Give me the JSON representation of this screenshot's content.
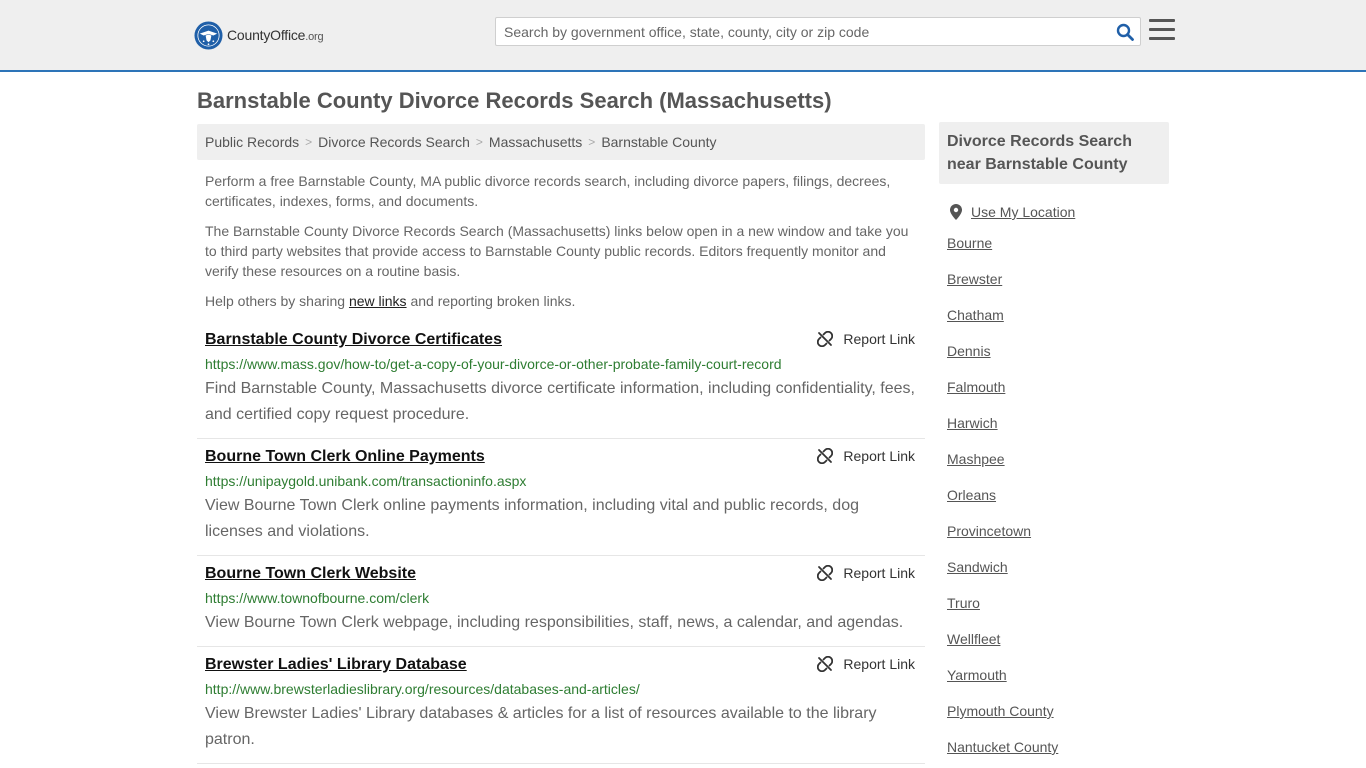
{
  "header": {
    "logo_text": "CountyOffice",
    "logo_org": ".org",
    "search_placeholder": "Search by government office, state, county, city or zip code"
  },
  "page_title": "Barnstable County Divorce Records Search (Massachusetts)",
  "breadcrumb": [
    "Public Records",
    "Divorce Records Search",
    "Massachusetts",
    "Barnstable County"
  ],
  "intro": {
    "p1": "Perform a free Barnstable County, MA public divorce records search, including divorce papers, filings, decrees, certificates, indexes, forms, and documents.",
    "p2": "The Barnstable County Divorce Records Search (Massachusetts) links below open in a new window and take you to third party websites that provide access to Barnstable County public records. Editors frequently monitor and verify these resources on a routine basis.",
    "p3_before": "Help others by sharing ",
    "p3_link": "new links",
    "p3_after": " and reporting broken links."
  },
  "report_label": "Report Link",
  "results": [
    {
      "title": "Barnstable County Divorce Certificates",
      "url": "https://www.mass.gov/how-to/get-a-copy-of-your-divorce-or-other-probate-family-court-record",
      "desc": "Find Barnstable County, Massachusetts divorce certificate information, including confidentiality, fees, and certified copy request procedure."
    },
    {
      "title": "Bourne Town Clerk Online Payments",
      "url": "https://unipaygold.unibank.com/transactioninfo.aspx",
      "desc": "View Bourne Town Clerk online payments information, including vital and public records, dog licenses and violations."
    },
    {
      "title": "Bourne Town Clerk Website",
      "url": "https://www.townofbourne.com/clerk",
      "desc": "View Bourne Town Clerk webpage, including responsibilities, staff, news, a calendar, and agendas."
    },
    {
      "title": "Brewster Ladies' Library Database",
      "url": "http://www.brewsterladieslibrary.org/resources/databases-and-articles/",
      "desc": "View Brewster Ladies' Library databases & articles for a list of resources available to the library patron."
    }
  ],
  "sidebar": {
    "title": "Divorce Records Search near Barnstable County",
    "use_location": "Use My Location",
    "items": [
      "Bourne",
      "Brewster",
      "Chatham",
      "Dennis",
      "Falmouth",
      "Harwich",
      "Mashpee",
      "Orleans",
      "Provincetown",
      "Sandwich",
      "Truro",
      "Wellfleet",
      "Yarmouth",
      "Plymouth County",
      "Nantucket County"
    ]
  },
  "colors": {
    "accent": "#2d74b8",
    "url_green": "#2e7d32",
    "logo_blue": "#1f5fa8"
  },
  "icons": {
    "search": "magnifier-icon",
    "menu": "hamburger-icon",
    "report": "broken-link-icon",
    "location": "map-pin-icon"
  }
}
